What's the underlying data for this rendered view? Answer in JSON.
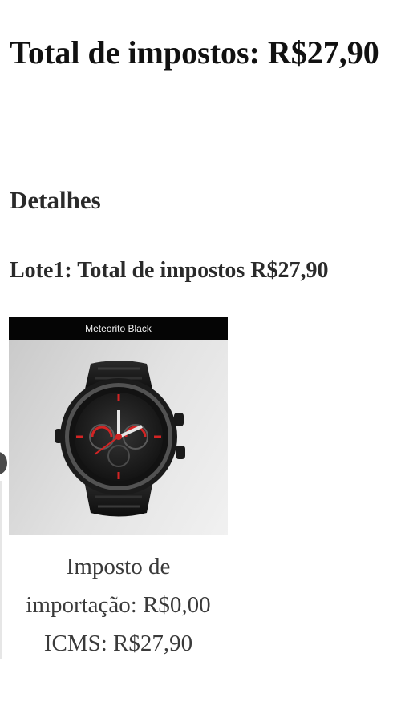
{
  "summary": {
    "total_label": "Total de impostos: R$27,90"
  },
  "details": {
    "heading": "Detalhes",
    "lots": [
      {
        "label": "Lote1: Total de impostos R$27,90",
        "product": {
          "banner_text": "Meteorito Black",
          "image_icon": "smartwatch-image",
          "taxes": [
            "Imposto de",
            "importação: R$0,00",
            "ICMS: R$27,90"
          ]
        }
      }
    ]
  },
  "colors": {
    "text": "#1f1f1f",
    "banner": "#050505",
    "accent": "#d22424"
  },
  "controls": {
    "scroll_icon": "carousel-previous-icon"
  }
}
